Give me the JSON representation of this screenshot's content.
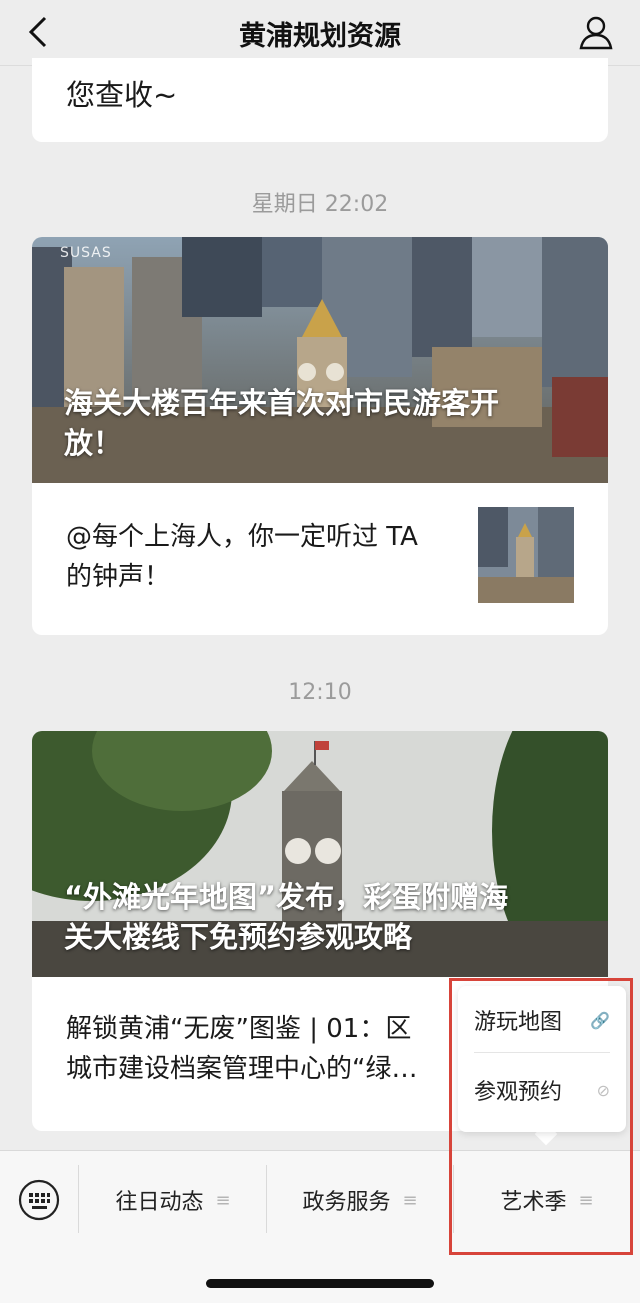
{
  "header": {
    "title": "黄浦规划资源"
  },
  "messages": [
    {
      "tail_text": "您查收~"
    },
    {
      "timestamp": "星期日 22:02",
      "cover_title": "海关大楼百年来首次对市民游客开放！",
      "cover_title_lines": [
        "海关大楼百年来首次对市民游客开",
        "放！"
      ],
      "watermark": "SUSAS",
      "sub_title_lines": [
        "@每个上海人，你一定听过 TA",
        "的钟声！"
      ]
    },
    {
      "timestamp": "12:10",
      "cover_title_lines": [
        "“外滩光年地图”发布，彩蛋附赠海",
        "关大楼线下免预约参观攻略"
      ],
      "sub_title_lines": [
        "解锁黄浦“无废”图鉴 | 01：区",
        "城市建设档案管理中心的“绿…"
      ]
    }
  ],
  "menu": {
    "items": [
      {
        "label": "往日动态",
        "icon": "menu-lines-icon"
      },
      {
        "label": "政务服务",
        "icon": "menu-lines-icon"
      },
      {
        "label": "艺术季",
        "icon": "menu-lines-icon"
      }
    ],
    "submenu": [
      {
        "label": "游玩地图",
        "icon": "link-icon"
      },
      {
        "label": "参观预约",
        "icon": "miniprogram-icon"
      }
    ]
  },
  "colors": {
    "highlight": "#d7443a",
    "background": "#ededed"
  }
}
